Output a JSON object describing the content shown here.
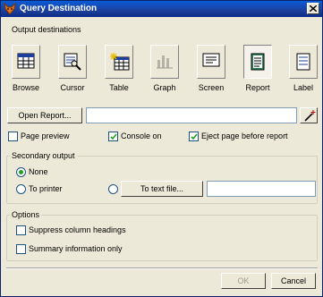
{
  "window": {
    "title": "Query Destination"
  },
  "output": {
    "heading": "Output destinations",
    "items": [
      {
        "label": "Browse",
        "icon": "browse-icon"
      },
      {
        "label": "Cursor",
        "icon": "cursor-icon"
      },
      {
        "label": "Table",
        "icon": "table-icon"
      },
      {
        "label": "Graph",
        "icon": "graph-icon"
      },
      {
        "label": "Screen",
        "icon": "screen-icon"
      },
      {
        "label": "Report",
        "icon": "report-icon"
      },
      {
        "label": "Label",
        "icon": "label-icon"
      }
    ],
    "selected": "Report"
  },
  "report": {
    "open_button": "Open Report...",
    "path_value": ""
  },
  "checks": {
    "page_preview": "Page preview",
    "page_preview_checked": false,
    "console_on": "Console on",
    "console_on_checked": true,
    "eject": "Eject page before report",
    "eject_checked": true
  },
  "secondary": {
    "title": "Secondary output",
    "none": "None",
    "to_printer": "To printer",
    "to_text_file": "To text file...",
    "text_file_value": "",
    "selected": "None"
  },
  "options": {
    "title": "Options",
    "suppress": "Suppress column headings",
    "summary": "Summary information only"
  },
  "footer": {
    "ok": "OK",
    "cancel": "Cancel"
  }
}
